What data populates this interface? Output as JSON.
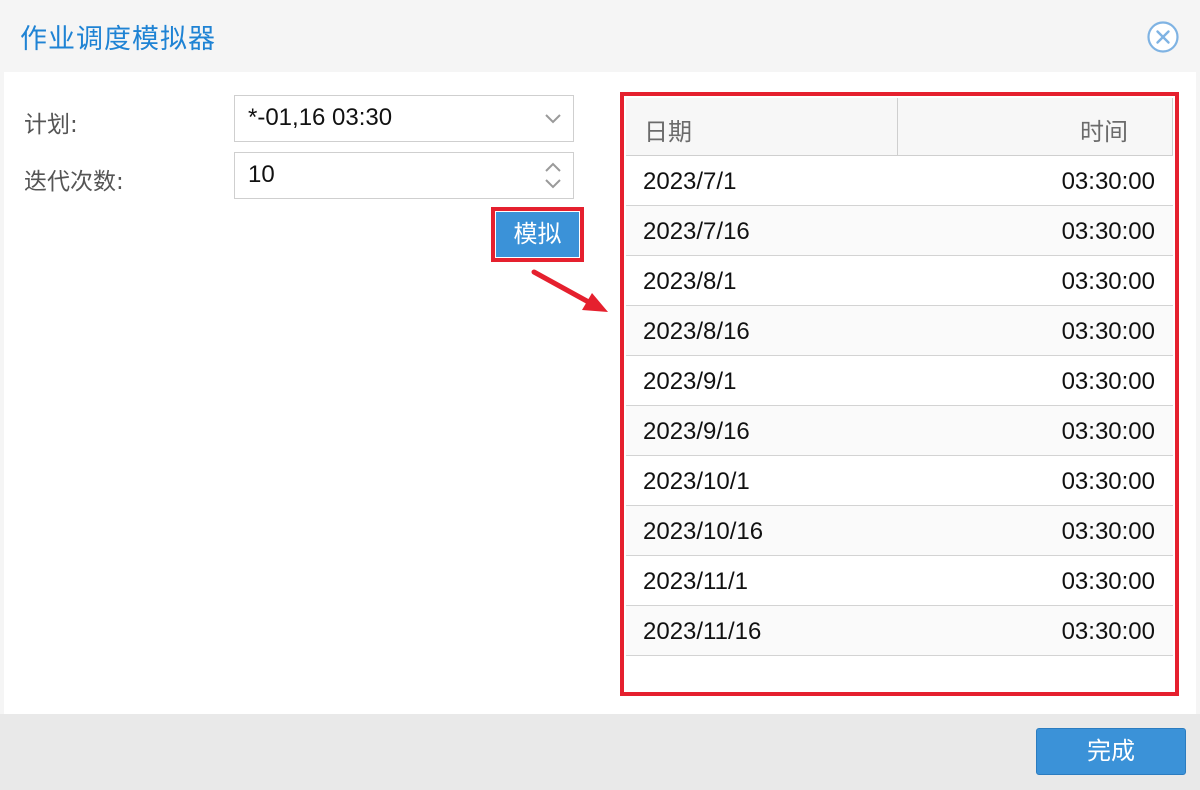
{
  "dialog": {
    "title": "作业调度模拟器",
    "close_icon": "close-circle-icon"
  },
  "form": {
    "schedule_label": "计划:",
    "schedule_value": "*-01,16 03:30",
    "iterations_label": "迭代次数:",
    "iterations_value": "10",
    "simulate_label": "模拟"
  },
  "grid": {
    "columns": [
      "日期",
      "时间"
    ],
    "rows": [
      {
        "date": "2023/7/1",
        "time": "03:30:00"
      },
      {
        "date": "2023/7/16",
        "time": "03:30:00"
      },
      {
        "date": "2023/8/1",
        "time": "03:30:00"
      },
      {
        "date": "2023/8/16",
        "time": "03:30:00"
      },
      {
        "date": "2023/9/1",
        "time": "03:30:00"
      },
      {
        "date": "2023/9/16",
        "time": "03:30:00"
      },
      {
        "date": "2023/10/1",
        "time": "03:30:00"
      },
      {
        "date": "2023/10/16",
        "time": "03:30:00"
      },
      {
        "date": "2023/11/1",
        "time": "03:30:00"
      },
      {
        "date": "2023/11/16",
        "time": "03:30:00"
      }
    ]
  },
  "footer": {
    "done_label": "完成"
  },
  "colors": {
    "accent": "#3b92d8",
    "title": "#1f83d4",
    "highlight": "#e5202e"
  }
}
